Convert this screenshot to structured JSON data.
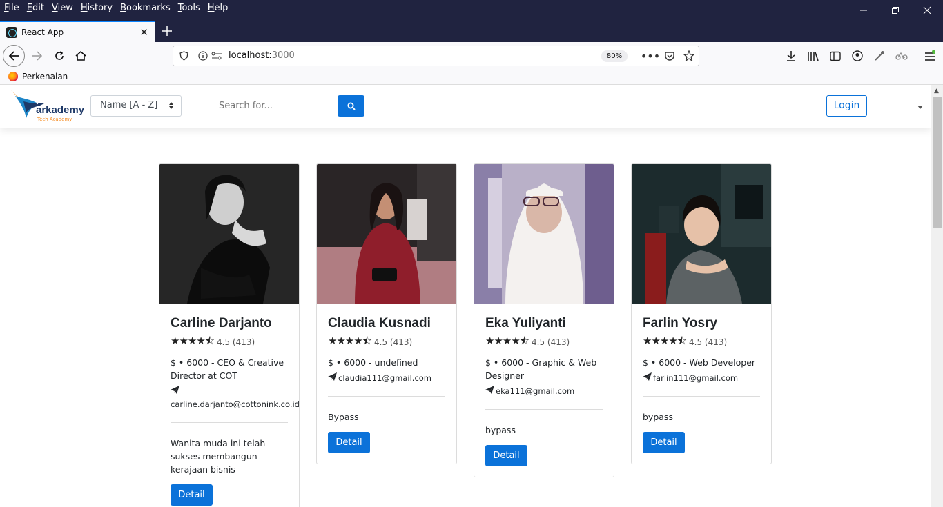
{
  "browser": {
    "menu": [
      "File",
      "Edit",
      "View",
      "History",
      "Bookmarks",
      "Tools",
      "Help"
    ],
    "tab_title": "React App",
    "url_host": "localhost:",
    "url_port": "3000",
    "zoom": "80%",
    "bookmark": "Perkenalan"
  },
  "header": {
    "logo_text": "arkademy",
    "logo_sub": "Tech Academy",
    "sort_value": "Name [A - Z]",
    "search_placeholder": "Search for...",
    "login_label": "Login"
  },
  "cards": [
    {
      "name": "Carline Darjanto",
      "rating": "4.5",
      "reviews": "(413)",
      "job": "$ • 6000 - CEO & Creative Director at COT",
      "email": "carline.darjanto@cottonink.co.id",
      "description": "Wanita muda ini telah sukses membangun kerajaan bisnis",
      "button": "Detail"
    },
    {
      "name": "Claudia Kusnadi",
      "rating": "4.5",
      "reviews": "(413)",
      "job": "$ • 6000 - undefined",
      "email": "claudia111@gmail.com",
      "description": "Bypass",
      "button": "Detail"
    },
    {
      "name": "Eka Yuliyanti",
      "rating": "4.5",
      "reviews": "(413)",
      "job": "$ • 6000 - Graphic & Web Designer",
      "email": "eka111@gmail.com",
      "description": "bypass",
      "button": "Detail"
    },
    {
      "name": "Farlin Yosry",
      "rating": "4.5",
      "reviews": "(413)",
      "job": "$ • 6000 - Web Developer",
      "email": "farlin111@gmail.com",
      "description": "bypass",
      "button": "Detail"
    }
  ],
  "icons": {
    "star": "star-icon",
    "plane": "paper-plane-icon",
    "search": "search-icon"
  },
  "colors": {
    "primary": "#0b72d9",
    "titlebar": "#202340"
  }
}
